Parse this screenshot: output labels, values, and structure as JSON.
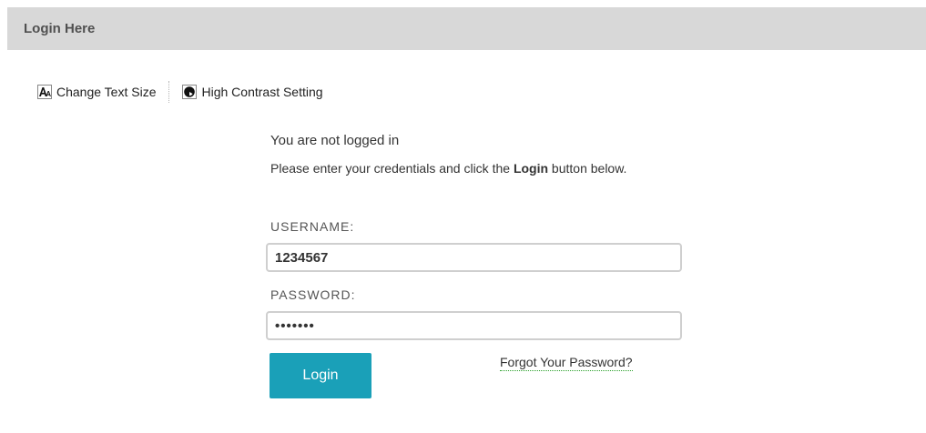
{
  "header": {
    "title": "Login Here"
  },
  "accessibility": {
    "text_size_label": "Change Text Size",
    "text_size_icon": "text-size-icon",
    "contrast_label": "High Contrast Setting",
    "contrast_icon": "contrast-icon"
  },
  "login": {
    "status": "You are not logged in",
    "instructions_prefix": "Please enter your credentials and click the ",
    "instructions_bold": "Login",
    "instructions_suffix": " button below.",
    "username_label": "USERNAME:",
    "username_value": "1234567",
    "password_label": "PASSWORD:",
    "password_value": "1234567",
    "login_button_label": "Login",
    "forgot_password_label": "Forgot Your Password?"
  },
  "colors": {
    "header_background": "#d8d8d8",
    "button_background": "#1aa0b8",
    "link_underline": "#2aa02a"
  }
}
